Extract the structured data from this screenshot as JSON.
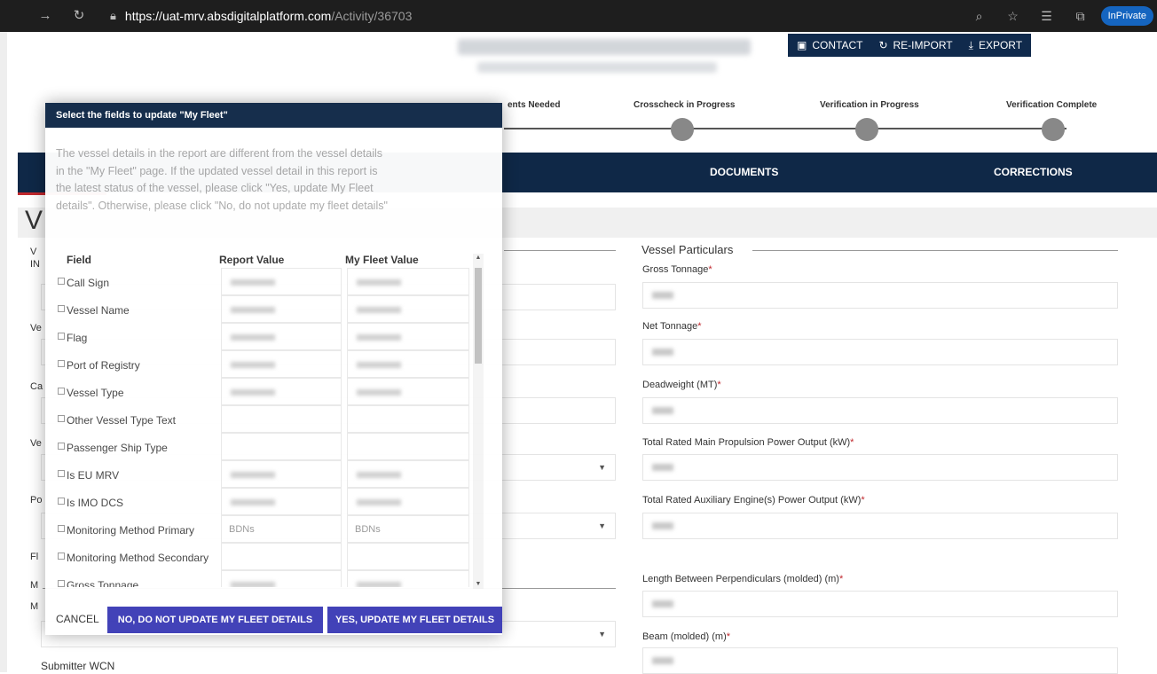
{
  "browser": {
    "url_main": "https://uat-mrv.absdigitalplatform.com",
    "url_path": "/Activity/36703",
    "badge": "InPrivate"
  },
  "header": {
    "actions": [
      {
        "label": "CONTACT",
        "icon": "contact-card-icon"
      },
      {
        "label": "RE-IMPORT",
        "icon": "refresh-icon"
      },
      {
        "label": "EXPORT",
        "icon": "download-icon"
      }
    ]
  },
  "steps": [
    "ents Needed",
    "Crosscheck in Progress",
    "Verification in Progress",
    "Verification Complete"
  ],
  "tabs": [
    "DOCUMENTS",
    "CORRECTIONS"
  ],
  "section_letter": "V",
  "vessel_particulars": {
    "title": "Vessel Particulars",
    "fields": [
      {
        "label": "Gross Tonnage"
      },
      {
        "label": "Net Tonnage"
      },
      {
        "label": "Deadweight (MT)"
      },
      {
        "label": "Total Rated Main Propulsion Power Output (kW)"
      },
      {
        "label": "Total Rated Auxiliary Engine(s) Power Output (kW)"
      },
      {
        "label": "Length Between Perpendiculars (molded) (m)"
      },
      {
        "label": "Beam (molded) (m)"
      }
    ],
    "required_mark": "*"
  },
  "left_fragments": [
    "V",
    "IN",
    "Ve",
    "Ca",
    "Ve",
    "Po",
    "Fl",
    "M",
    "M"
  ],
  "submitter_label": "Submitter WCN",
  "modal": {
    "title": "Select the fields to update \"My Fleet\"",
    "message": "The vessel details in the report are different from the vessel details in the \"My Fleet\" page. If the updated vessel detail in this report is the latest status of the vessel, please click \"Yes, update My Fleet details\". Otherwise, please click \"No, do not update my fleet details\"",
    "columns": [
      "Field",
      "Report Value",
      "My Fleet Value"
    ],
    "rows": [
      {
        "field": "Call Sign",
        "report": "",
        "fleet": "",
        "blurred": true
      },
      {
        "field": "Vessel Name",
        "report": "",
        "fleet": "",
        "blurred": true
      },
      {
        "field": "Flag",
        "report": "",
        "fleet": "",
        "blurred": true
      },
      {
        "field": "Port of Registry",
        "report": "",
        "fleet": "",
        "blurred": true
      },
      {
        "field": "Vessel Type",
        "report": "",
        "fleet": "",
        "blurred": true
      },
      {
        "field": "Other Vessel Type Text",
        "report": "",
        "fleet": "",
        "blurred": false
      },
      {
        "field": "Passenger Ship Type",
        "report": "",
        "fleet": "",
        "blurred": false
      },
      {
        "field": "Is EU MRV",
        "report": "",
        "fleet": "",
        "blurred": true
      },
      {
        "field": "Is IMO DCS",
        "report": "",
        "fleet": "",
        "blurred": true
      },
      {
        "field": "Monitoring Method Primary",
        "report": "BDNs",
        "fleet": "BDNs",
        "blurred": false
      },
      {
        "field": "Monitoring Method Secondary",
        "report": "",
        "fleet": "",
        "blurred": false
      },
      {
        "field": "Gross Tonnage",
        "report": "",
        "fleet": "",
        "blurred": true
      }
    ],
    "buttons": {
      "cancel": "CANCEL",
      "no": "NO, DO NOT UPDATE MY FLEET DETAILS",
      "yes": "YES, UPDATE MY FLEET DETAILS"
    }
  }
}
